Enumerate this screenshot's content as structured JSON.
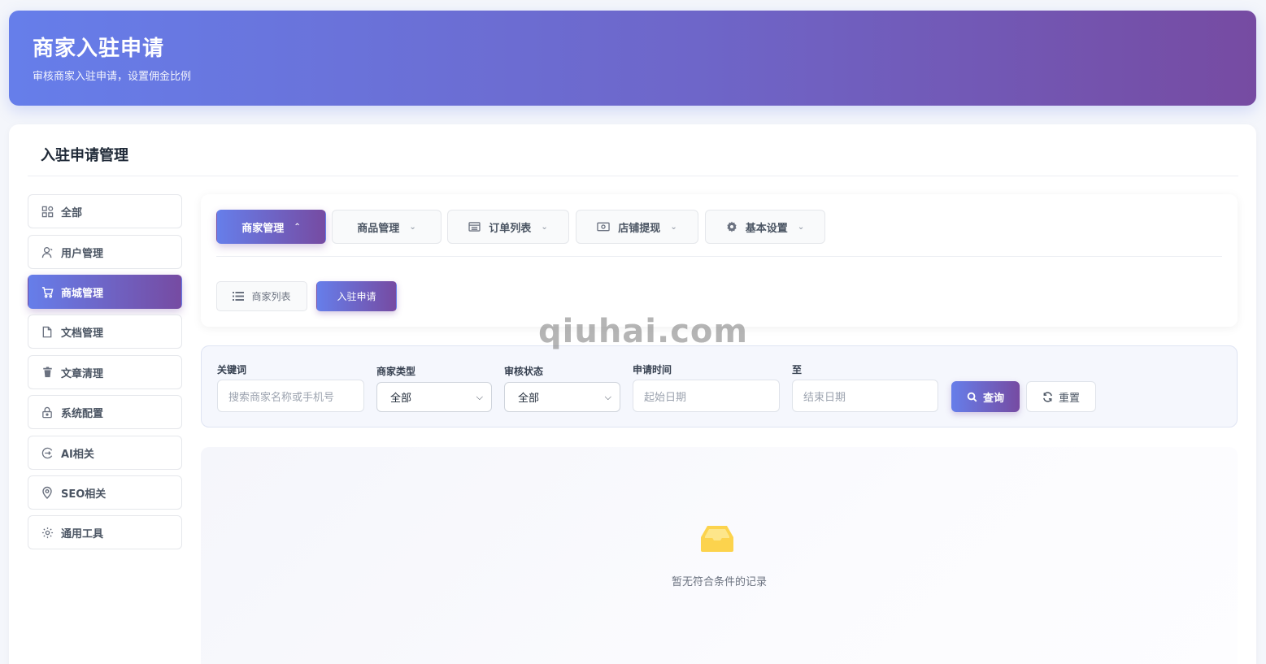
{
  "header": {
    "title": "商家入驻申请",
    "subtitle": "审核商家入驻申请，设置佣金比例"
  },
  "card": {
    "title": "入驻申请管理"
  },
  "sidebar": {
    "items": [
      {
        "label": "全部",
        "icon": "grid-icon"
      },
      {
        "label": "用户管理",
        "icon": "user-icon"
      },
      {
        "label": "商城管理",
        "icon": "cart-icon",
        "active": true
      },
      {
        "label": "文档管理",
        "icon": "document-icon"
      },
      {
        "label": "文章清理",
        "icon": "trash-icon"
      },
      {
        "label": "系统配置",
        "icon": "lock-icon"
      },
      {
        "label": "AI相关",
        "icon": "ai-icon"
      },
      {
        "label": "SEO相关",
        "icon": "location-pin-icon"
      },
      {
        "label": "通用工具",
        "icon": "gear-icon"
      }
    ]
  },
  "tabs": [
    {
      "label": "商家管理",
      "active": true
    },
    {
      "label": "商品管理"
    },
    {
      "label": "订单列表",
      "icon": "list-table-icon"
    },
    {
      "label": "店铺提现",
      "icon": "money-icon"
    },
    {
      "label": "基本设置",
      "icon": "gear-icon"
    }
  ],
  "subtabs": [
    {
      "label": "商家列表",
      "icon": "list-icon"
    },
    {
      "label": "入驻申请",
      "active": true
    }
  ],
  "filter": {
    "keyword_label": "关键词",
    "keyword_placeholder": "搜索商家名称或手机号",
    "type_label": "商家类型",
    "type_value": "全部",
    "status_label": "审核状态",
    "status_value": "全部",
    "time_label": "申请时间",
    "start_placeholder": "起始日期",
    "to_label": "至",
    "end_placeholder": "结束日期",
    "query_label": "查询",
    "reset_label": "重置"
  },
  "empty": {
    "text": "暂无符合条件的记录"
  },
  "watermark": "qiuhai.com",
  "colors": {
    "accent_start": "#667eea",
    "accent_end": "#764ba2",
    "empty_icon": "#fcd34d"
  }
}
